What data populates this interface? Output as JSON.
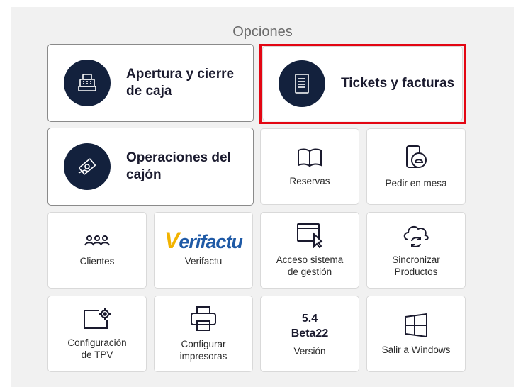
{
  "header": {
    "title": "Opciones"
  },
  "tiles": {
    "cash_open_close": {
      "label": "Apertura y cierre de caja"
    },
    "tickets_invoices": {
      "label": "Tickets y facturas"
    },
    "drawer_operations": {
      "label": "Operaciones del cajón"
    },
    "reservations": {
      "label": "Reservas"
    },
    "table_order": {
      "label": "Pedir en mesa"
    },
    "clients": {
      "label": "Clientes"
    },
    "verifactu": {
      "label": "Verifactu",
      "logo_text": "erifactu",
      "logo_initial": "V"
    },
    "management_access": {
      "label": "Acceso sistema de gestión"
    },
    "sync_products": {
      "label": "Sincronizar Productos"
    },
    "tpv_config": {
      "label": "Configuración de TPV"
    },
    "printer_config": {
      "label": "Configurar impresoras"
    },
    "version": {
      "number": "5.4",
      "build": "Beta22",
      "label": "Versión"
    },
    "exit_windows": {
      "label": "Salir a Windows"
    }
  },
  "icons": {
    "cash_open_close": "cash-register-icon",
    "tickets_invoices": "receipt-icon",
    "drawer_operations": "money-hand-icon",
    "reservations": "book-icon",
    "table_order": "phone-bell-icon",
    "clients": "users-icon",
    "management_access": "window-cursor-icon",
    "sync_products": "cloud-sync-icon",
    "tpv_config": "screen-gear-icon",
    "printer_config": "printer-icon",
    "exit_windows": "windows-icon"
  },
  "colors": {
    "icon_circle": "#13213d",
    "highlight": "#e30613",
    "brand_blue": "#1f5aa6",
    "brand_yellow": "#f2b300"
  }
}
